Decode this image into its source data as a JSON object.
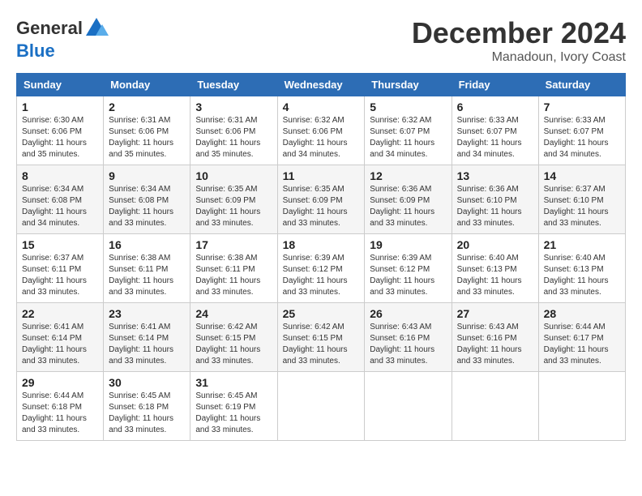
{
  "logo": {
    "general": "General",
    "blue": "Blue"
  },
  "title": "December 2024",
  "location": "Manadoun, Ivory Coast",
  "days_of_week": [
    "Sunday",
    "Monday",
    "Tuesday",
    "Wednesday",
    "Thursday",
    "Friday",
    "Saturday"
  ],
  "weeks": [
    [
      {
        "day": "1",
        "sunrise": "6:30 AM",
        "sunset": "6:06 PM",
        "daylight": "11 hours and 35 minutes."
      },
      {
        "day": "2",
        "sunrise": "6:31 AM",
        "sunset": "6:06 PM",
        "daylight": "11 hours and 35 minutes."
      },
      {
        "day": "3",
        "sunrise": "6:31 AM",
        "sunset": "6:06 PM",
        "daylight": "11 hours and 35 minutes."
      },
      {
        "day": "4",
        "sunrise": "6:32 AM",
        "sunset": "6:06 PM",
        "daylight": "11 hours and 34 minutes."
      },
      {
        "day": "5",
        "sunrise": "6:32 AM",
        "sunset": "6:07 PM",
        "daylight": "11 hours and 34 minutes."
      },
      {
        "day": "6",
        "sunrise": "6:33 AM",
        "sunset": "6:07 PM",
        "daylight": "11 hours and 34 minutes."
      },
      {
        "day": "7",
        "sunrise": "6:33 AM",
        "sunset": "6:07 PM",
        "daylight": "11 hours and 34 minutes."
      }
    ],
    [
      {
        "day": "8",
        "sunrise": "6:34 AM",
        "sunset": "6:08 PM",
        "daylight": "11 hours and 34 minutes."
      },
      {
        "day": "9",
        "sunrise": "6:34 AM",
        "sunset": "6:08 PM",
        "daylight": "11 hours and 33 minutes."
      },
      {
        "day": "10",
        "sunrise": "6:35 AM",
        "sunset": "6:09 PM",
        "daylight": "11 hours and 33 minutes."
      },
      {
        "day": "11",
        "sunrise": "6:35 AM",
        "sunset": "6:09 PM",
        "daylight": "11 hours and 33 minutes."
      },
      {
        "day": "12",
        "sunrise": "6:36 AM",
        "sunset": "6:09 PM",
        "daylight": "11 hours and 33 minutes."
      },
      {
        "day": "13",
        "sunrise": "6:36 AM",
        "sunset": "6:10 PM",
        "daylight": "11 hours and 33 minutes."
      },
      {
        "day": "14",
        "sunrise": "6:37 AM",
        "sunset": "6:10 PM",
        "daylight": "11 hours and 33 minutes."
      }
    ],
    [
      {
        "day": "15",
        "sunrise": "6:37 AM",
        "sunset": "6:11 PM",
        "daylight": "11 hours and 33 minutes."
      },
      {
        "day": "16",
        "sunrise": "6:38 AM",
        "sunset": "6:11 PM",
        "daylight": "11 hours and 33 minutes."
      },
      {
        "day": "17",
        "sunrise": "6:38 AM",
        "sunset": "6:11 PM",
        "daylight": "11 hours and 33 minutes."
      },
      {
        "day": "18",
        "sunrise": "6:39 AM",
        "sunset": "6:12 PM",
        "daylight": "11 hours and 33 minutes."
      },
      {
        "day": "19",
        "sunrise": "6:39 AM",
        "sunset": "6:12 PM",
        "daylight": "11 hours and 33 minutes."
      },
      {
        "day": "20",
        "sunrise": "6:40 AM",
        "sunset": "6:13 PM",
        "daylight": "11 hours and 33 minutes."
      },
      {
        "day": "21",
        "sunrise": "6:40 AM",
        "sunset": "6:13 PM",
        "daylight": "11 hours and 33 minutes."
      }
    ],
    [
      {
        "day": "22",
        "sunrise": "6:41 AM",
        "sunset": "6:14 PM",
        "daylight": "11 hours and 33 minutes."
      },
      {
        "day": "23",
        "sunrise": "6:41 AM",
        "sunset": "6:14 PM",
        "daylight": "11 hours and 33 minutes."
      },
      {
        "day": "24",
        "sunrise": "6:42 AM",
        "sunset": "6:15 PM",
        "daylight": "11 hours and 33 minutes."
      },
      {
        "day": "25",
        "sunrise": "6:42 AM",
        "sunset": "6:15 PM",
        "daylight": "11 hours and 33 minutes."
      },
      {
        "day": "26",
        "sunrise": "6:43 AM",
        "sunset": "6:16 PM",
        "daylight": "11 hours and 33 minutes."
      },
      {
        "day": "27",
        "sunrise": "6:43 AM",
        "sunset": "6:16 PM",
        "daylight": "11 hours and 33 minutes."
      },
      {
        "day": "28",
        "sunrise": "6:44 AM",
        "sunset": "6:17 PM",
        "daylight": "11 hours and 33 minutes."
      }
    ],
    [
      {
        "day": "29",
        "sunrise": "6:44 AM",
        "sunset": "6:18 PM",
        "daylight": "11 hours and 33 minutes."
      },
      {
        "day": "30",
        "sunrise": "6:45 AM",
        "sunset": "6:18 PM",
        "daylight": "11 hours and 33 minutes."
      },
      {
        "day": "31",
        "sunrise": "6:45 AM",
        "sunset": "6:19 PM",
        "daylight": "11 hours and 33 minutes."
      },
      null,
      null,
      null,
      null
    ]
  ],
  "labels": {
    "sunrise": "Sunrise:",
    "sunset": "Sunset:",
    "daylight": "Daylight:"
  }
}
